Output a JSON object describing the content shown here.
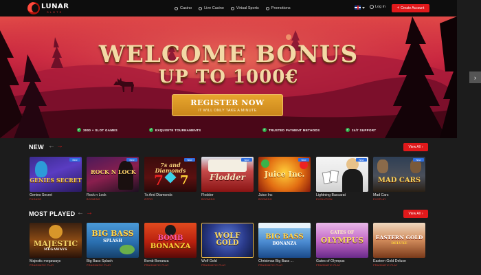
{
  "header": {
    "logo": {
      "word": "LUNAR",
      "sub": "SLOTS"
    },
    "nav": [
      {
        "label": "Casino",
        "icon": "casino-icon"
      },
      {
        "label": "Live Casino",
        "icon": "live-casino-icon"
      },
      {
        "label": "Virtual Sports",
        "icon": "virtual-sports-icon"
      },
      {
        "label": "Promotions",
        "icon": "promotions-icon"
      }
    ],
    "language_icon": "uk-flag-icon",
    "login_label": "Log in",
    "create_account_label": "Create Account",
    "create_account_icon": "plus-icon"
  },
  "hero": {
    "title_line1": "WELCOME BONUS",
    "title_line2": "UP TO 1000€",
    "register_label": "REGISTER NOW",
    "register_sub": "IT WILL ONLY TAKE A MINUTE",
    "features": [
      "3000 + SLOT GAMES",
      "EXQUISITE TOURNAMENTS",
      "TRUSTED PAYMENT METHODS",
      "24/7 SUPPORT"
    ],
    "colors": {
      "sky_top": "#e14a47",
      "sky_bottom": "#5a0a1f",
      "title": "#f3d9a6",
      "button": "#d99523"
    }
  },
  "sections": {
    "new": {
      "title": "NEW",
      "view_all_label": "View All",
      "games": [
        {
          "name": "Genies Secret",
          "provider": "FUGASO",
          "badge": "New",
          "art": "GENIES SECRET"
        },
        {
          "name": "Rock n Lock",
          "provider": "BOOMING",
          "badge": "New",
          "art": "ROCK N LOCK"
        },
        {
          "name": "7s And Diamonds",
          "provider": "ZITRO",
          "badge": "New",
          "art": "7s and Diamonds"
        },
        {
          "name": "Flodder",
          "provider": "BOOMING",
          "badge": "New",
          "art": "Flodder"
        },
        {
          "name": "Juice Inc",
          "provider": "BOOMING",
          "badge": "New",
          "art": "Juice Inc."
        },
        {
          "name": "Lightning Baccarat",
          "provider": "EVOLUTION",
          "badge": "New",
          "art": ""
        },
        {
          "name": "Mad Cars",
          "provider": "EVOPLAY",
          "badge": "New",
          "art": "MAD CARS"
        }
      ]
    },
    "most_played": {
      "title": "MOST PLAYED",
      "view_all_label": "View All",
      "games": [
        {
          "name": "Majestic megaways",
          "provider": "PRAGMATIC PLAY",
          "art": "MAJESTIC",
          "art_sub": "MEGAWAYS"
        },
        {
          "name": "Big Bass Splash",
          "provider": "PRAGMATIC PLAY",
          "art": "BIG BASS",
          "art_sub": "SPLASH"
        },
        {
          "name": "Bomb Bonanza",
          "provider": "PRAGMATIC PLAY",
          "art": "BOMB",
          "art_sub": "BONANZA"
        },
        {
          "name": "Wolf Gold",
          "provider": "PRAGMATIC PLAY",
          "art": "WOLF",
          "art_sub": "GOLD"
        },
        {
          "name": "Christmas Big Bass ...",
          "provider": "PRAGMATIC PLAY",
          "art": "BIG BASS",
          "art_sub": "BONANZA"
        },
        {
          "name": "Gates of Olympus",
          "provider": "PRAGMATIC PLAY",
          "art": "GATES OF",
          "art_sub": "OLYMPUS"
        },
        {
          "name": "Eastern Gold Deluxe",
          "provider": "PRAGMATIC PLAY",
          "art": "EASTERN GOLD",
          "art_sub": "DELUXE"
        }
      ]
    }
  },
  "colors": {
    "accent": "#e0191b",
    "badge": "#2f6fe0",
    "provider": "#e03b2f",
    "check": "#2bb14a"
  }
}
